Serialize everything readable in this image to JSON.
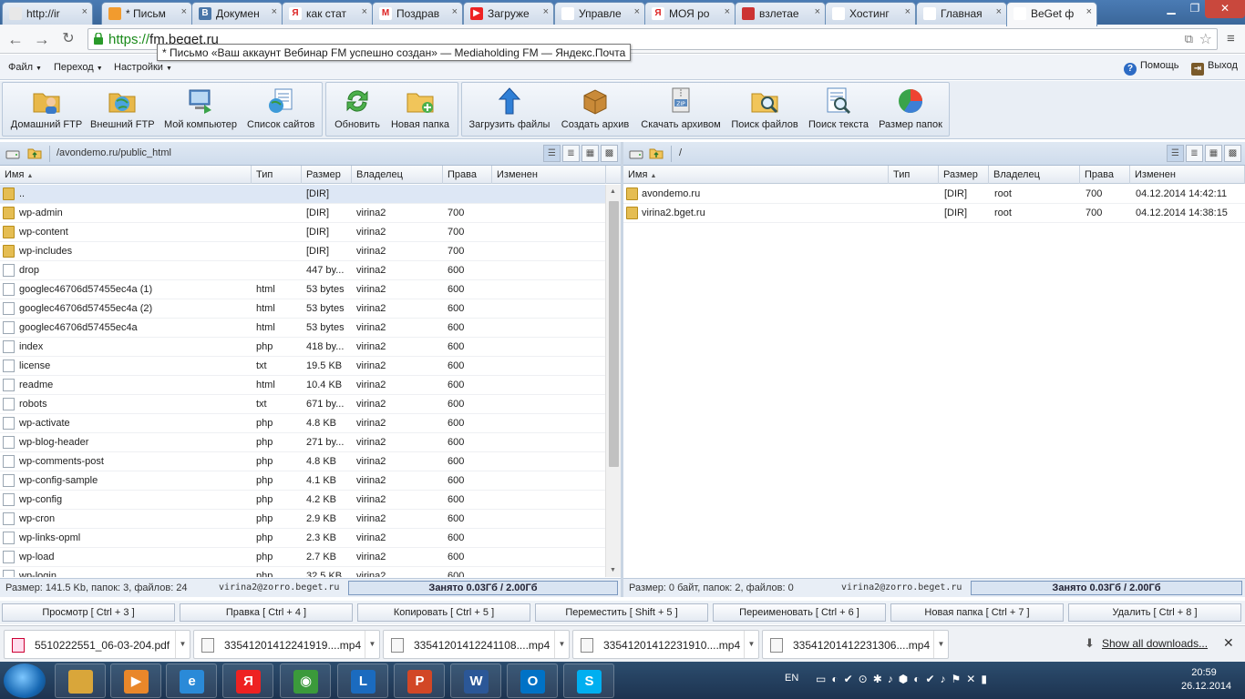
{
  "browser": {
    "tabs": [
      {
        "label": "http://ir",
        "fav": "#e8e8e8",
        "fav_text": ""
      },
      {
        "label": "* Письм",
        "fav": "#f29b2e",
        "fav_text": ""
      },
      {
        "label": "Докумен",
        "fav": "#4a76a8",
        "fav_text": "B"
      },
      {
        "label": "как стат",
        "fav": "#fff",
        "fav_text": "Я"
      },
      {
        "label": "Поздрав",
        "fav": "#fff",
        "fav_text": "M"
      },
      {
        "label": "Загруже",
        "fav": "#e22",
        "fav_text": "▶"
      },
      {
        "label": "Управле",
        "fav": "#fff",
        "fav_text": ""
      },
      {
        "label": "МОЯ ро",
        "fav": "#fff",
        "fav_text": "Я"
      },
      {
        "label": "взлетае",
        "fav": "#c33",
        "fav_text": ""
      },
      {
        "label": "Хостинг",
        "fav": "#fff",
        "fav_text": ""
      },
      {
        "label": "Главная",
        "fav": "#fff",
        "fav_text": ""
      },
      {
        "label": "BeGet ф",
        "fav": "#fff",
        "fav_text": ""
      }
    ],
    "url_scheme": "https://",
    "url_host": "fm.beget.ru",
    "tooltip": "* Письмо «Ваш аккаунт Вебинар FM успешно создан» — Mediaholding FM — Яндекс.Почта"
  },
  "menu": {
    "file": "Файл",
    "goto": "Переход",
    "settings": "Настройки",
    "help": "Помощь",
    "logout": "Выход"
  },
  "toolbar": {
    "home_ftp": "Домашний FTP",
    "ext_ftp": "Внешний FTP",
    "my_computer": "Мой компьютер",
    "site_list": "Список сайтов",
    "refresh": "Обновить",
    "new_folder": "Новая папка",
    "upload": "Загрузить файлы",
    "create_archive": "Создать архив",
    "download_archive": "Скачать архивом",
    "search_files": "Поиск файлов",
    "search_text": "Поиск текста",
    "folder_size": "Размер папок"
  },
  "columns": {
    "name": "Имя",
    "type": "Тип",
    "size": "Размер",
    "owner": "Владелец",
    "perms": "Права",
    "modified": "Изменен"
  },
  "left": {
    "path": "/avondemo.ru/public_html",
    "rows": [
      {
        "icon": "folder",
        "name": "..",
        "type": "",
        "size": "[DIR]",
        "owner": "",
        "perms": "",
        "modified": "",
        "selected": true
      },
      {
        "icon": "folder",
        "name": "wp-admin",
        "type": "",
        "size": "[DIR]",
        "owner": "virina2",
        "perms": "700",
        "modified": ""
      },
      {
        "icon": "folder",
        "name": "wp-content",
        "type": "",
        "size": "[DIR]",
        "owner": "virina2",
        "perms": "700",
        "modified": ""
      },
      {
        "icon": "folder",
        "name": "wp-includes",
        "type": "",
        "size": "[DIR]",
        "owner": "virina2",
        "perms": "700",
        "modified": ""
      },
      {
        "icon": "doc",
        "name": "drop",
        "type": "",
        "size": "447 by...",
        "owner": "virina2",
        "perms": "600",
        "modified": ""
      },
      {
        "icon": "doc",
        "name": "googlec46706d57455ec4a (1)",
        "type": "html",
        "size": "53 bytes",
        "owner": "virina2",
        "perms": "600",
        "modified": ""
      },
      {
        "icon": "doc",
        "name": "googlec46706d57455ec4a (2)",
        "type": "html",
        "size": "53 bytes",
        "owner": "virina2",
        "perms": "600",
        "modified": ""
      },
      {
        "icon": "doc",
        "name": "googlec46706d57455ec4a",
        "type": "html",
        "size": "53 bytes",
        "owner": "virina2",
        "perms": "600",
        "modified": ""
      },
      {
        "icon": "doc",
        "name": "index",
        "type": "php",
        "size": "418 by...",
        "owner": "virina2",
        "perms": "600",
        "modified": ""
      },
      {
        "icon": "doc",
        "name": "license",
        "type": "txt",
        "size": "19.5 KB",
        "owner": "virina2",
        "perms": "600",
        "modified": ""
      },
      {
        "icon": "doc",
        "name": "readme",
        "type": "html",
        "size": "10.4 KB",
        "owner": "virina2",
        "perms": "600",
        "modified": ""
      },
      {
        "icon": "doc",
        "name": "robots",
        "type": "txt",
        "size": "671 by...",
        "owner": "virina2",
        "perms": "600",
        "modified": ""
      },
      {
        "icon": "doc",
        "name": "wp-activate",
        "type": "php",
        "size": "4.8 KB",
        "owner": "virina2",
        "perms": "600",
        "modified": ""
      },
      {
        "icon": "doc",
        "name": "wp-blog-header",
        "type": "php",
        "size": "271 by...",
        "owner": "virina2",
        "perms": "600",
        "modified": ""
      },
      {
        "icon": "doc",
        "name": "wp-comments-post",
        "type": "php",
        "size": "4.8 KB",
        "owner": "virina2",
        "perms": "600",
        "modified": ""
      },
      {
        "icon": "doc",
        "name": "wp-config-sample",
        "type": "php",
        "size": "4.1 KB",
        "owner": "virina2",
        "perms": "600",
        "modified": ""
      },
      {
        "icon": "doc",
        "name": "wp-config",
        "type": "php",
        "size": "4.2 KB",
        "owner": "virina2",
        "perms": "600",
        "modified": ""
      },
      {
        "icon": "doc",
        "name": "wp-cron",
        "type": "php",
        "size": "2.9 KB",
        "owner": "virina2",
        "perms": "600",
        "modified": ""
      },
      {
        "icon": "doc",
        "name": "wp-links-opml",
        "type": "php",
        "size": "2.3 KB",
        "owner": "virina2",
        "perms": "600",
        "modified": ""
      },
      {
        "icon": "doc",
        "name": "wp-load",
        "type": "php",
        "size": "2.7 KB",
        "owner": "virina2",
        "perms": "600",
        "modified": ""
      },
      {
        "icon": "doc",
        "name": "wp-login",
        "type": "php",
        "size": "32.5 KB",
        "owner": "virina2",
        "perms": "600",
        "modified": ""
      }
    ],
    "status": "Размер: 141.5 Kb, папок: 3, файлов: 24",
    "account": "virina2@zorro.beget.ru",
    "quota": "Занято 0.03Гб / 2.00Гб"
  },
  "right": {
    "path": "/",
    "rows": [
      {
        "icon": "folder",
        "name": "avondemo.ru",
        "type": "",
        "size": "[DIR]",
        "owner": "root",
        "perms": "700",
        "modified": "04.12.2014 14:42:11"
      },
      {
        "icon": "folder",
        "name": "virina2.bget.ru",
        "type": "",
        "size": "[DIR]",
        "owner": "root",
        "perms": "700",
        "modified": "04.12.2014 14:38:15"
      }
    ],
    "status": "Размер: 0 байт, папок: 2, файлов: 0",
    "account": "virina2@zorro.beget.ru",
    "quota": "Занято 0.03Гб / 2.00Гб"
  },
  "fkeys": [
    "Просмотр [ Ctrl + 3 ]",
    "Правка [ Ctrl + 4 ]",
    "Копировать [ Ctrl + 5 ]",
    "Переместить [ Shift + 5 ]",
    "Переименовать [ Ctrl + 6 ]",
    "Новая папка [ Ctrl + 7 ]",
    "Удалить [ Ctrl + 8 ]"
  ],
  "downloads": {
    "items": [
      {
        "name": "5510222551_06-03-204.pdf",
        "kind": "pdf"
      },
      {
        "name": "33541201412241919....mp4",
        "kind": "video"
      },
      {
        "name": "33541201412241108....mp4",
        "kind": "video"
      },
      {
        "name": "33541201412231910....mp4",
        "kind": "video"
      },
      {
        "name": "33541201412231306....mp4",
        "kind": "video"
      }
    ],
    "show_all": "Show all downloads..."
  },
  "taskbar": {
    "apps": [
      {
        "name": "explorer",
        "color": "#d9a63a",
        "glyph": ""
      },
      {
        "name": "media",
        "color": "#e9872a",
        "glyph": "▶"
      },
      {
        "name": "ie",
        "color": "#2a8ad8",
        "glyph": "e"
      },
      {
        "name": "yandex",
        "color": "#e22",
        "glyph": "Я"
      },
      {
        "name": "chrome",
        "color": "#3b9a3b",
        "glyph": "◉"
      },
      {
        "name": "lync",
        "color": "#1b6bbf",
        "glyph": "L"
      },
      {
        "name": "powerpoint",
        "color": "#d24726",
        "glyph": "P"
      },
      {
        "name": "word",
        "color": "#2b5797",
        "glyph": "W"
      },
      {
        "name": "outlook",
        "color": "#0072c6",
        "glyph": "O"
      },
      {
        "name": "skype",
        "color": "#00aff0",
        "glyph": "S"
      }
    ],
    "lang": "EN",
    "time": "20:59",
    "date": "26.12.2014"
  }
}
